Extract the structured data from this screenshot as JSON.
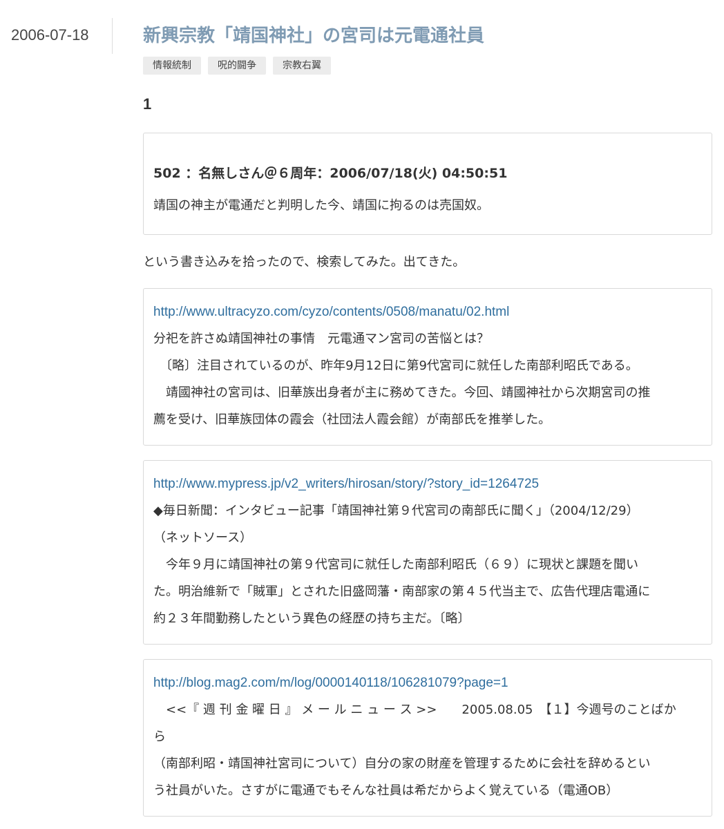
{
  "post": {
    "date": "2006-07-18",
    "title": "新興宗教「靖国神社」の宮司は元電通社員",
    "tags": [
      "情報統制",
      "呪的闘争",
      "宗教右翼"
    ],
    "section_number": "1"
  },
  "quote1": {
    "header": "502 ：名無しさん＠６周年：2006/07/18(火) 04:50:51",
    "body": "靖国の神主が電通だと判明した今、靖国に拘るのは売国奴。"
  },
  "intro": "という書き込みを拾ったので、検索してみた。出てきた。",
  "quote2": {
    "url": "http://www.ultracyzo.com/cyzo/contents/0508/manatu/02.html",
    "lines": [
      "分祀を許さぬ靖国神社の事情　元電通マン宮司の苦悩とは？",
      "　〔略〕注目されているのが、昨年9月12日に第9代宮司に就任した南部利昭氏である。",
      "　靖國神社の宮司は、旧華族出身者が主に務めてきた。今回、靖國神社から次期宮司の推",
      "薦を受け、旧華族団体の霞会（社団法人霞会館）が南部氏を推挙した。"
    ]
  },
  "quote3": {
    "url": "http://www.mypress.jp/v2_writers/hirosan/story/?story_id=1264725",
    "lines": [
      "◆毎日新聞：インタビュー記事「靖国神社第９代宮司の南部氏に聞く」（2004/12/29）",
      "（ネットソース）",
      "　今年９月に靖国神社の第９代宮司に就任した南部利昭氏（６９）に現状と課題を聞い",
      "た。明治維新で「賊軍」とされた旧盛岡藩・南部家の第４５代当主で、広告代理店電通に",
      "約２３年間勤務したという異色の経歴の持ち主だ。〔略〕"
    ]
  },
  "quote4": {
    "url": "http://blog.mag2.com/m/log/0000140118/106281079?page=1",
    "lines": [
      "　<<『 週 刊 金 曜 日 』 メ ー ル ニ ュ ー ス >>　　2005.08.05　【１】今週号のことばか",
      "ら",
      "（南部利昭・靖国神社宮司について）自分の家の財産を管理するために会社を辞めるとい",
      "う社員がいた。さすがに電通でもそんな社員は希だからよく覚えている（電通OB）"
    ]
  }
}
